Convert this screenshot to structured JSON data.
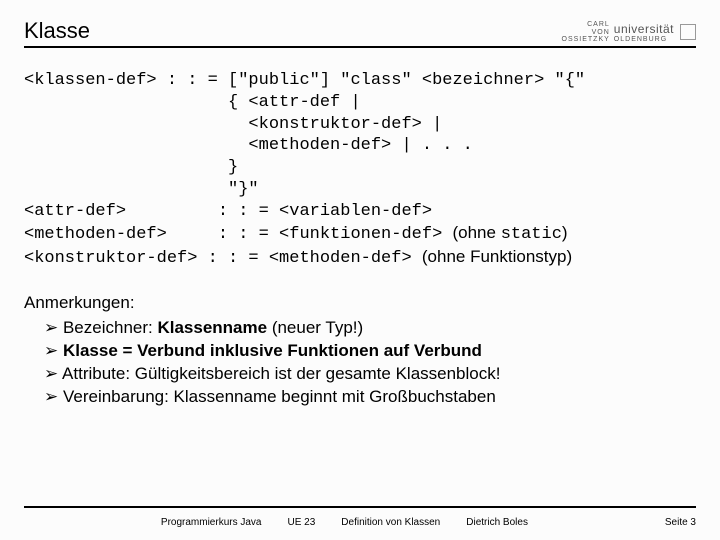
{
  "header": {
    "title": "Klasse",
    "logo": {
      "line1": "CARL",
      "line2": "VON",
      "line3": "OSSIETZKY",
      "word": "universität",
      "sub": "OLDENBURG"
    }
  },
  "grammar": {
    "line1": "<klassen-def> : : = [\"public\"] \"class\" <bezeichner> \"{\"",
    "line2": "                    { <attr-def |",
    "line3": "                      <konstruktor-def> |",
    "line4": "                      <methoden-def> | . . .",
    "line5": "                    }",
    "line6": "                    \"}\"",
    "line7a": "<attr-def>         : : = <variablen-def>",
    "line8a": "<methoden-def>     : : = <funktionen-def> ",
    "line8b": "(ohne ",
    "line8c": "static",
    "line8d": ")",
    "line9a": "<konstruktor-def> : : = <methoden-def> ",
    "line9b": "(ohne Funktionstyp)"
  },
  "remarks": {
    "title": "Anmerkungen:",
    "items": [
      {
        "pre": "Bezeichner: ",
        "bold": "Klassenname",
        "post": " (neuer Typ!)"
      },
      {
        "pre": "",
        "bold": "Klasse = Verbund inklusive Funktionen auf Verbund",
        "post": ""
      },
      {
        "pre": "Attribute: Gültigkeitsbereich ist der gesamte Klassenblock!",
        "bold": "",
        "post": ""
      },
      {
        "pre": "Vereinbarung: Klassenname beginnt mit Großbuchstaben",
        "bold": "",
        "post": ""
      }
    ]
  },
  "footer": {
    "left": "",
    "c1": "Programmierkurs Java",
    "c2": "UE 23",
    "c3": "Definition von Klassen",
    "c4": "Dietrich Boles",
    "right": "Seite 3"
  }
}
